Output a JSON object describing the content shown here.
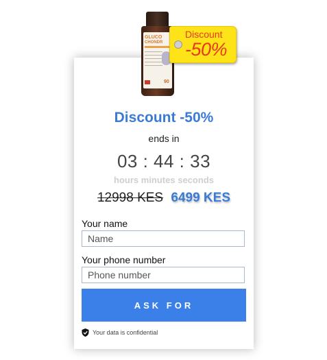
{
  "tag": {
    "line1": "Discount",
    "line2": "-50%"
  },
  "bottle_label": {
    "brand": "GLUCO",
    "sub": "CHONDR",
    "count": "90"
  },
  "offer": {
    "title": "Discount -50%",
    "ends_in": "ends in",
    "timer": "03 : 44 : 33",
    "units": "hours minutes seconds",
    "old_price": "12998 KES",
    "new_price": "6499 KES"
  },
  "form": {
    "name_label": "Your name",
    "name_placeholder": "Name",
    "phone_label": "Your phone number",
    "phone_placeholder": "Phone number",
    "submit_label": "ASK FOR",
    "confidential_note": "Your data is confidential"
  },
  "colors": {
    "accent": "#3a7bd5",
    "button": "#3a80e8",
    "tag_bg": "#fde317",
    "tag_text": "#e53a1e"
  }
}
